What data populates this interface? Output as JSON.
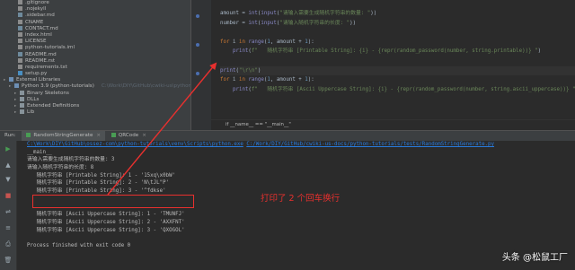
{
  "project_tree": {
    "items": [
      {
        "label": ".gitignore",
        "icon": "file-icon"
      },
      {
        "label": ".nojekyll",
        "icon": "file-icon"
      },
      {
        "label": ".sidebar.md",
        "icon": "md-icon"
      },
      {
        "label": "CNAME",
        "icon": "file-icon"
      },
      {
        "label": "CONTACT.md",
        "icon": "md-icon"
      },
      {
        "label": "index.html",
        "icon": "file-icon"
      },
      {
        "label": "LICENSE",
        "icon": "file-icon"
      },
      {
        "label": "python-tutorials.iml",
        "icon": "file-icon"
      },
      {
        "label": "README.md",
        "icon": "md-icon"
      },
      {
        "label": "README.rst",
        "icon": "file-icon"
      },
      {
        "label": "requirements.txt",
        "icon": "file-icon"
      },
      {
        "label": "setup.py",
        "icon": "py-icon"
      }
    ],
    "external": {
      "label": "External Libraries"
    },
    "python": {
      "label": "Python 3.9 (python-tutorials)",
      "hint": "C:\\Work\\DIY\\GitHub\\cwiki-us\\python-tutorials\\venv\\Scripts\\python.exe"
    },
    "sub_items": [
      {
        "label": "Binary Skeletons"
      },
      {
        "label": "DLLs"
      },
      {
        "label": "Extended Definitions"
      },
      {
        "label": "Lib"
      }
    ]
  },
  "editor": {
    "lines": [
      {
        "parts": [
          {
            "t": "amount = ",
            "c": ""
          },
          {
            "t": "int",
            "c": "fn"
          },
          {
            "t": "(",
            "c": ""
          },
          {
            "t": "input",
            "c": "fn"
          },
          {
            "t": "(",
            "c": ""
          },
          {
            "t": "\"请输入需要生成随机字符串的数量: \"",
            "c": "str"
          },
          {
            "t": "))",
            "c": ""
          }
        ]
      },
      {
        "parts": [
          {
            "t": "number = ",
            "c": ""
          },
          {
            "t": "int",
            "c": "fn"
          },
          {
            "t": "(",
            "c": ""
          },
          {
            "t": "input",
            "c": "fn"
          },
          {
            "t": "(",
            "c": ""
          },
          {
            "t": "\"请输入随机字符串的长度: \"",
            "c": "str"
          },
          {
            "t": "))",
            "c": ""
          }
        ]
      },
      {
        "parts": [
          {
            "t": "",
            "c": ""
          }
        ]
      },
      {
        "parts": [
          {
            "t": "for ",
            "c": "kw"
          },
          {
            "t": "i ",
            "c": ""
          },
          {
            "t": "in ",
            "c": "kw"
          },
          {
            "t": "range",
            "c": "fn"
          },
          {
            "t": "(",
            "c": ""
          },
          {
            "t": "1",
            "c": "num"
          },
          {
            "t": ", amount + ",
            "c": ""
          },
          {
            "t": "1",
            "c": "num"
          },
          {
            "t": "):",
            "c": ""
          }
        ]
      },
      {
        "parts": [
          {
            "t": "    ",
            "c": ""
          },
          {
            "t": "print",
            "c": "fn"
          },
          {
            "t": "(",
            "c": ""
          },
          {
            "t": "f\"   随机字符串 [Printable String]: {i} - {repr(random_password(number, string.printable))} \"",
            "c": "str"
          },
          {
            "t": ")",
            "c": ""
          }
        ]
      },
      {
        "parts": [
          {
            "t": "",
            "c": ""
          }
        ]
      },
      {
        "parts": [
          {
            "t": "print",
            "c": "fn"
          },
          {
            "t": "(",
            "c": ""
          },
          {
            "t": "\"\\r\\n\"",
            "c": "str"
          },
          {
            "t": ")",
            "c": ""
          }
        ],
        "hl": true
      },
      {
        "parts": [
          {
            "t": "for ",
            "c": "kw"
          },
          {
            "t": "i ",
            "c": ""
          },
          {
            "t": "in ",
            "c": "kw"
          },
          {
            "t": "range",
            "c": "fn"
          },
          {
            "t": "(",
            "c": ""
          },
          {
            "t": "1",
            "c": "num"
          },
          {
            "t": ", amount + ",
            "c": ""
          },
          {
            "t": "1",
            "c": "num"
          },
          {
            "t": "):",
            "c": ""
          }
        ]
      },
      {
        "parts": [
          {
            "t": "    ",
            "c": ""
          },
          {
            "t": "print",
            "c": "fn"
          },
          {
            "t": "(",
            "c": ""
          },
          {
            "t": "f\"   随机字符串 [Ascii Uppercase String]: {i} - {repr(random_password(number, string.ascii_uppercase))} \"",
            "c": "str"
          },
          {
            "t": ")",
            "c": ""
          }
        ]
      }
    ],
    "breadcrumb": "if __name__ == \"__main__\""
  },
  "run_window": {
    "run_label": "Run:",
    "tabs": [
      {
        "label": "RandomStringGenerate",
        "active": true,
        "close": "×"
      },
      {
        "label": "QRCode",
        "active": false,
        "close": "×"
      }
    ],
    "toolbar": [
      "▶",
      "▲",
      "▼",
      "■",
      "⇌",
      "≡",
      "⎙",
      "🗑"
    ]
  },
  "console": {
    "cmd_exe": "C:\\Work\\DIY\\GitHub\\ossez-com\\python-tutorials\\venv\\Scripts\\python.exe",
    "cmd_script": "C:/Work/DIY/GitHub/cwiki-us-docs/python-tutorials/tests/RandomStringGenerate.py",
    "lines": [
      {
        "text": "__main__",
        "indent": false
      },
      {
        "text": "请输入需要生成随机字符串的数量: 3",
        "indent": false
      },
      {
        "text": "请输入随机字符串的长度: 8",
        "indent": false
      },
      {
        "text": "   随机字符串 [Printable String]: 1 - '15xq\\x0bW'",
        "indent": false
      },
      {
        "text": "   随机字符串 [Printable String]: 2 - 'N\\tJL\"P'",
        "indent": false
      },
      {
        "text": "   随机字符串 [Printable String]: 3 - '^fdkse'",
        "indent": false
      },
      {
        "text": "",
        "indent": false
      },
      {
        "text": "",
        "indent": false
      },
      {
        "text": "   随机字符串 [Ascii Uppercase String]: 1 - 'TMUNFJ'",
        "indent": false
      },
      {
        "text": "   随机字符串 [Ascii Uppercase String]: 2 - 'AXXFNT'",
        "indent": false
      },
      {
        "text": "   随机字符串 [Ascii Uppercase String]: 3 - 'QXOGOL'",
        "indent": false
      },
      {
        "text": "",
        "indent": false
      },
      {
        "text": "Process finished with exit code 0",
        "indent": false
      }
    ]
  },
  "annotation": {
    "text": "打印了 2 个回车换行",
    "color": "#e8302e"
  },
  "watermark": "头条 @松鼠工厂"
}
